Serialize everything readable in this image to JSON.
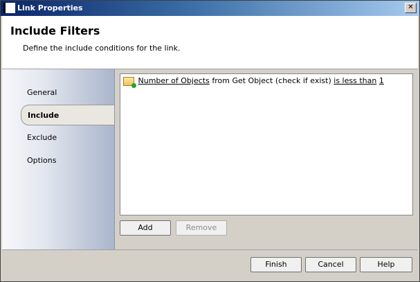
{
  "window": {
    "title": "Link Properties",
    "close_glyph": "✕"
  },
  "header": {
    "title": "Include Filters",
    "description": "Define the include conditions for the link."
  },
  "nav": {
    "items": [
      {
        "label": "General"
      },
      {
        "label": "Include"
      },
      {
        "label": "Exclude"
      },
      {
        "label": "Options"
      }
    ],
    "selected": "Include"
  },
  "filter": {
    "rule": {
      "property": "Number of Objects",
      "text_from": "from Get Object (check if exist)",
      "operator": "is less than",
      "value": "1",
      "icon": "filter-rule-icon"
    },
    "buttons": {
      "add": "Add",
      "remove": "Remove"
    }
  },
  "footer": {
    "finish": "Finish",
    "cancel": "Cancel",
    "help": "Help"
  }
}
